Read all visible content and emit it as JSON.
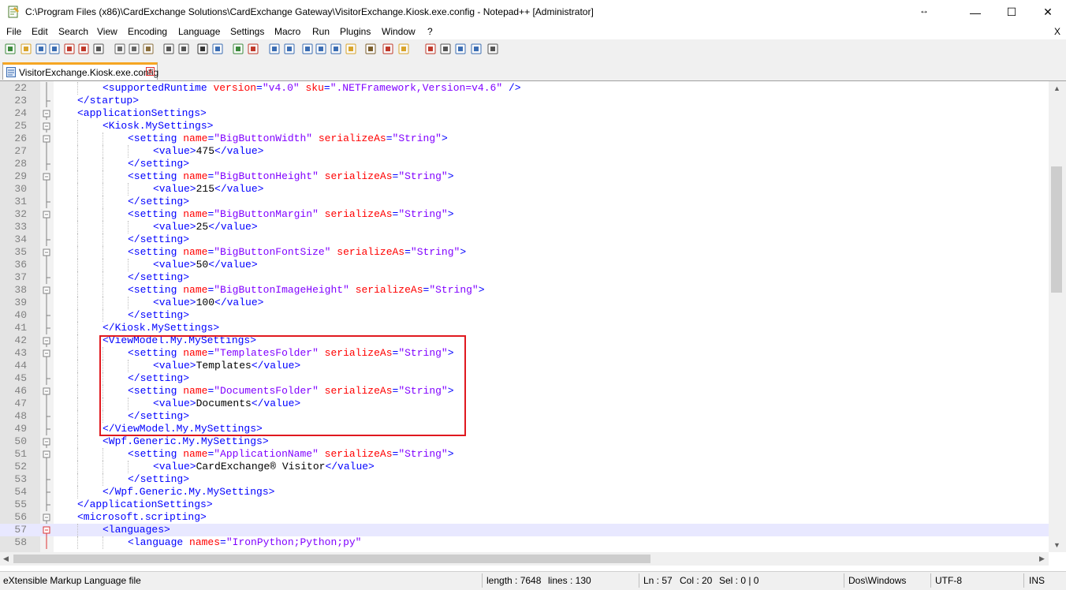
{
  "window": {
    "title": "C:\\Program Files (x86)\\CardExchange Solutions\\CardExchange Gateway\\VisitorExchange.Kiosk.exe.config - Notepad++ [Administrator]",
    "resize_glyph": "↔",
    "minimize": "—",
    "maximize": "☐",
    "close": "✕"
  },
  "menu": {
    "items": [
      "File",
      "Edit",
      "Search",
      "View",
      "Encoding",
      "Language",
      "Settings",
      "Macro",
      "Run",
      "Plugins",
      "Window",
      "?"
    ],
    "close_doc": "X"
  },
  "toolbar": {
    "icons": [
      "new-icon",
      "open-icon",
      "save-icon",
      "save-all-icon",
      "close-icon",
      "close-all-icon",
      "print-icon",
      "cut-icon",
      "copy-icon",
      "paste-icon",
      "undo-icon",
      "redo-icon",
      "find-icon",
      "replace-icon",
      "zoom-in-icon",
      "zoom-out-icon",
      "sync-vertical-icon",
      "sync-horizontal-icon",
      "word-wrap-icon",
      "show-all-chars-icon",
      "indent-guide-icon",
      "user-lang-icon",
      "doc-map-icon",
      "function-list-icon",
      "folder-workspace-icon",
      "record-macro-icon",
      "stop-record-icon",
      "play-macro-icon",
      "run-multiple-icon",
      "save-macro-icon"
    ]
  },
  "tab": {
    "label": "VisitorExchange.Kiosk.exe.config",
    "close": "✕"
  },
  "editor": {
    "current_line": "57",
    "lines": [
      {
        "n": "22",
        "fold": "line",
        "indent": 2,
        "parts": [
          [
            "t",
            "<supportedRuntime "
          ],
          [
            "a",
            "version"
          ],
          [
            "t",
            "="
          ],
          [
            "v",
            "\"v4.0\""
          ],
          [
            "a",
            " sku"
          ],
          [
            "t",
            "="
          ],
          [
            "v",
            "\".NETFramework,Version=v4.6\""
          ],
          [
            "t",
            " />"
          ]
        ]
      },
      {
        "n": "23",
        "fold": "end",
        "indent": 1,
        "parts": [
          [
            "t",
            "</startup>"
          ]
        ]
      },
      {
        "n": "24",
        "fold": "box",
        "indent": 1,
        "parts": [
          [
            "t",
            "<applicationSettings>"
          ]
        ]
      },
      {
        "n": "25",
        "fold": "box",
        "indent": 2,
        "parts": [
          [
            "t",
            "<Kiosk.MySettings>"
          ]
        ]
      },
      {
        "n": "26",
        "fold": "box",
        "indent": 3,
        "parts": [
          [
            "t",
            "<setting "
          ],
          [
            "a",
            "name"
          ],
          [
            "t",
            "="
          ],
          [
            "v",
            "\"BigButtonWidth\""
          ],
          [
            "a",
            " serializeAs"
          ],
          [
            "t",
            "="
          ],
          [
            "v",
            "\"String\""
          ],
          [
            "t",
            ">"
          ]
        ]
      },
      {
        "n": "27",
        "fold": "line",
        "indent": 4,
        "parts": [
          [
            "t",
            "<value>"
          ],
          [
            "tx",
            "475"
          ],
          [
            "t",
            "</value>"
          ]
        ]
      },
      {
        "n": "28",
        "fold": "end",
        "indent": 3,
        "parts": [
          [
            "t",
            "</setting>"
          ]
        ]
      },
      {
        "n": "29",
        "fold": "box",
        "indent": 3,
        "parts": [
          [
            "t",
            "<setting "
          ],
          [
            "a",
            "name"
          ],
          [
            "t",
            "="
          ],
          [
            "v",
            "\"BigButtonHeight\""
          ],
          [
            "a",
            " serializeAs"
          ],
          [
            "t",
            "="
          ],
          [
            "v",
            "\"String\""
          ],
          [
            "t",
            ">"
          ]
        ]
      },
      {
        "n": "30",
        "fold": "line",
        "indent": 4,
        "parts": [
          [
            "t",
            "<value>"
          ],
          [
            "tx",
            "215"
          ],
          [
            "t",
            "</value>"
          ]
        ]
      },
      {
        "n": "31",
        "fold": "end",
        "indent": 3,
        "parts": [
          [
            "t",
            "</setting>"
          ]
        ]
      },
      {
        "n": "32",
        "fold": "box",
        "indent": 3,
        "parts": [
          [
            "t",
            "<setting "
          ],
          [
            "a",
            "name"
          ],
          [
            "t",
            "="
          ],
          [
            "v",
            "\"BigButtonMargin\""
          ],
          [
            "a",
            " serializeAs"
          ],
          [
            "t",
            "="
          ],
          [
            "v",
            "\"String\""
          ],
          [
            "t",
            ">"
          ]
        ]
      },
      {
        "n": "33",
        "fold": "line",
        "indent": 4,
        "parts": [
          [
            "t",
            "<value>"
          ],
          [
            "tx",
            "25"
          ],
          [
            "t",
            "</value>"
          ]
        ]
      },
      {
        "n": "34",
        "fold": "end",
        "indent": 3,
        "parts": [
          [
            "t",
            "</setting>"
          ]
        ]
      },
      {
        "n": "35",
        "fold": "box",
        "indent": 3,
        "parts": [
          [
            "t",
            "<setting "
          ],
          [
            "a",
            "name"
          ],
          [
            "t",
            "="
          ],
          [
            "v",
            "\"BigButtonFontSize\""
          ],
          [
            "a",
            " serializeAs"
          ],
          [
            "t",
            "="
          ],
          [
            "v",
            "\"String\""
          ],
          [
            "t",
            ">"
          ]
        ]
      },
      {
        "n": "36",
        "fold": "line",
        "indent": 4,
        "parts": [
          [
            "t",
            "<value>"
          ],
          [
            "tx",
            "50"
          ],
          [
            "t",
            "</value>"
          ]
        ]
      },
      {
        "n": "37",
        "fold": "end",
        "indent": 3,
        "parts": [
          [
            "t",
            "</setting>"
          ]
        ]
      },
      {
        "n": "38",
        "fold": "box",
        "indent": 3,
        "parts": [
          [
            "t",
            "<setting "
          ],
          [
            "a",
            "name"
          ],
          [
            "t",
            "="
          ],
          [
            "v",
            "\"BigButtonImageHeight\""
          ],
          [
            "a",
            " serializeAs"
          ],
          [
            "t",
            "="
          ],
          [
            "v",
            "\"String\""
          ],
          [
            "t",
            ">"
          ]
        ]
      },
      {
        "n": "39",
        "fold": "line",
        "indent": 4,
        "parts": [
          [
            "t",
            "<value>"
          ],
          [
            "tx",
            "100"
          ],
          [
            "t",
            "</value>"
          ]
        ]
      },
      {
        "n": "40",
        "fold": "end",
        "indent": 3,
        "parts": [
          [
            "t",
            "</setting>"
          ]
        ]
      },
      {
        "n": "41",
        "fold": "end",
        "indent": 2,
        "parts": [
          [
            "t",
            "</Kiosk.MySettings>"
          ]
        ]
      },
      {
        "n": "42",
        "fold": "box",
        "indent": 2,
        "parts": [
          [
            "t",
            "<ViewModel.My.MySettings>"
          ]
        ]
      },
      {
        "n": "43",
        "fold": "box",
        "indent": 3,
        "parts": [
          [
            "t",
            "<setting "
          ],
          [
            "a",
            "name"
          ],
          [
            "t",
            "="
          ],
          [
            "v",
            "\"TemplatesFolder\""
          ],
          [
            "a",
            " serializeAs"
          ],
          [
            "t",
            "="
          ],
          [
            "v",
            "\"String\""
          ],
          [
            "t",
            ">"
          ]
        ]
      },
      {
        "n": "44",
        "fold": "line",
        "indent": 4,
        "parts": [
          [
            "t",
            "<value>"
          ],
          [
            "tx",
            "Templates"
          ],
          [
            "t",
            "</value>"
          ]
        ]
      },
      {
        "n": "45",
        "fold": "end",
        "indent": 3,
        "parts": [
          [
            "t",
            "</setting>"
          ]
        ]
      },
      {
        "n": "46",
        "fold": "box",
        "indent": 3,
        "parts": [
          [
            "t",
            "<setting "
          ],
          [
            "a",
            "name"
          ],
          [
            "t",
            "="
          ],
          [
            "v",
            "\"DocumentsFolder\""
          ],
          [
            "a",
            " serializeAs"
          ],
          [
            "t",
            "="
          ],
          [
            "v",
            "\"String\""
          ],
          [
            "t",
            ">"
          ]
        ]
      },
      {
        "n": "47",
        "fold": "line",
        "indent": 4,
        "parts": [
          [
            "t",
            "<value>"
          ],
          [
            "tx",
            "Documents"
          ],
          [
            "t",
            "</value>"
          ]
        ]
      },
      {
        "n": "48",
        "fold": "end",
        "indent": 3,
        "parts": [
          [
            "t",
            "</setting>"
          ]
        ]
      },
      {
        "n": "49",
        "fold": "end",
        "indent": 2,
        "parts": [
          [
            "t",
            "</ViewModel.My.MySettings>"
          ]
        ]
      },
      {
        "n": "50",
        "fold": "box",
        "indent": 2,
        "parts": [
          [
            "t",
            "<Wpf.Generic.My.MySettings>"
          ]
        ]
      },
      {
        "n": "51",
        "fold": "box",
        "indent": 3,
        "parts": [
          [
            "t",
            "<setting "
          ],
          [
            "a",
            "name"
          ],
          [
            "t",
            "="
          ],
          [
            "v",
            "\"ApplicationName\""
          ],
          [
            "a",
            " serializeAs"
          ],
          [
            "t",
            "="
          ],
          [
            "v",
            "\"String\""
          ],
          [
            "t",
            ">"
          ]
        ]
      },
      {
        "n": "52",
        "fold": "line",
        "indent": 4,
        "parts": [
          [
            "t",
            "<value>"
          ],
          [
            "tx",
            "CardExchange® Visitor"
          ],
          [
            "t",
            "</value>"
          ]
        ]
      },
      {
        "n": "53",
        "fold": "end",
        "indent": 3,
        "parts": [
          [
            "t",
            "</setting>"
          ]
        ]
      },
      {
        "n": "54",
        "fold": "end",
        "indent": 2,
        "parts": [
          [
            "t",
            "</Wpf.Generic.My.MySettings>"
          ]
        ]
      },
      {
        "n": "55",
        "fold": "end",
        "indent": 1,
        "parts": [
          [
            "t",
            "</applicationSettings>"
          ]
        ]
      },
      {
        "n": "56",
        "fold": "box",
        "indent": 1,
        "parts": [
          [
            "t",
            "<microsoft.scripting>"
          ]
        ]
      },
      {
        "n": "57",
        "fold": "redbox",
        "indent": 2,
        "parts": [
          [
            "t",
            "<languages>"
          ]
        ]
      },
      {
        "n": "58",
        "fold": "redline",
        "indent": 3,
        "parts": [
          [
            "t",
            "<language "
          ],
          [
            "a",
            "names"
          ],
          [
            "t",
            "="
          ],
          [
            "v",
            "\"IronPython;Python;py\""
          ]
        ]
      }
    ]
  },
  "status": {
    "file_type": "eXtensible Markup Language file",
    "length": "length : 7648",
    "lines": "lines : 130",
    "ln": "Ln : 57",
    "col": "Col : 20",
    "sel": "Sel : 0 | 0",
    "eol": "Dos\\Windows",
    "encoding": "UTF-8",
    "mode": "INS"
  },
  "colors": {
    "tag": "#0000ff",
    "attribute": "#ff0000",
    "value": "#8000ff",
    "highlight_box": "#e0191f",
    "tab_accent": "#f5a623"
  }
}
